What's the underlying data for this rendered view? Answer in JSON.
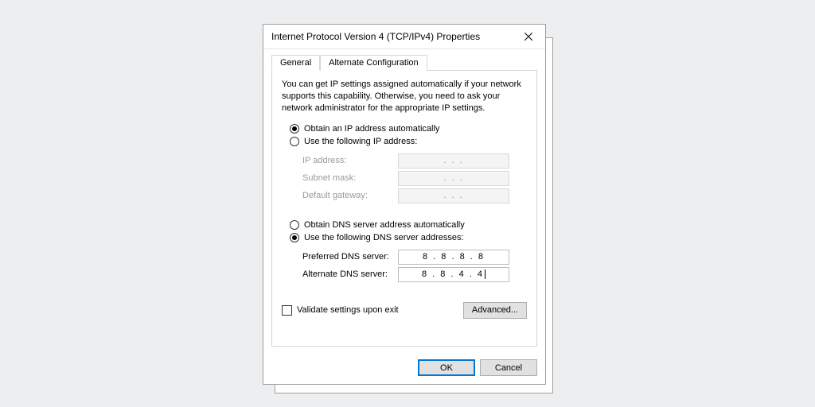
{
  "dialog": {
    "title": "Internet Protocol Version 4 (TCP/IPv4) Properties"
  },
  "tabs": {
    "general": "General",
    "alternate": "Alternate Configuration"
  },
  "description": "You can get IP settings assigned automatically if your network supports this capability. Otherwise, you need to ask your network administrator for the appropriate IP settings.",
  "ip": {
    "auto_label": "Obtain an IP address automatically",
    "manual_label": "Use the following IP address:",
    "address_label": "IP address:",
    "subnet_label": "Subnet mask:",
    "gateway_label": "Default gateway:",
    "address_value": ".       .       .",
    "subnet_value": ".       .       .",
    "gateway_value": ".       .       ."
  },
  "dns": {
    "auto_label": "Obtain DNS server address automatically",
    "manual_label": "Use the following DNS server addresses:",
    "preferred_label": "Preferred DNS server:",
    "alternate_label": "Alternate DNS server:",
    "preferred_value": "8  .  8  .  8  .  8",
    "alternate_value": "8  .  8  .  4  .  4"
  },
  "validate_label": "Validate settings upon exit",
  "buttons": {
    "advanced": "Advanced...",
    "ok": "OK",
    "cancel": "Cancel"
  }
}
